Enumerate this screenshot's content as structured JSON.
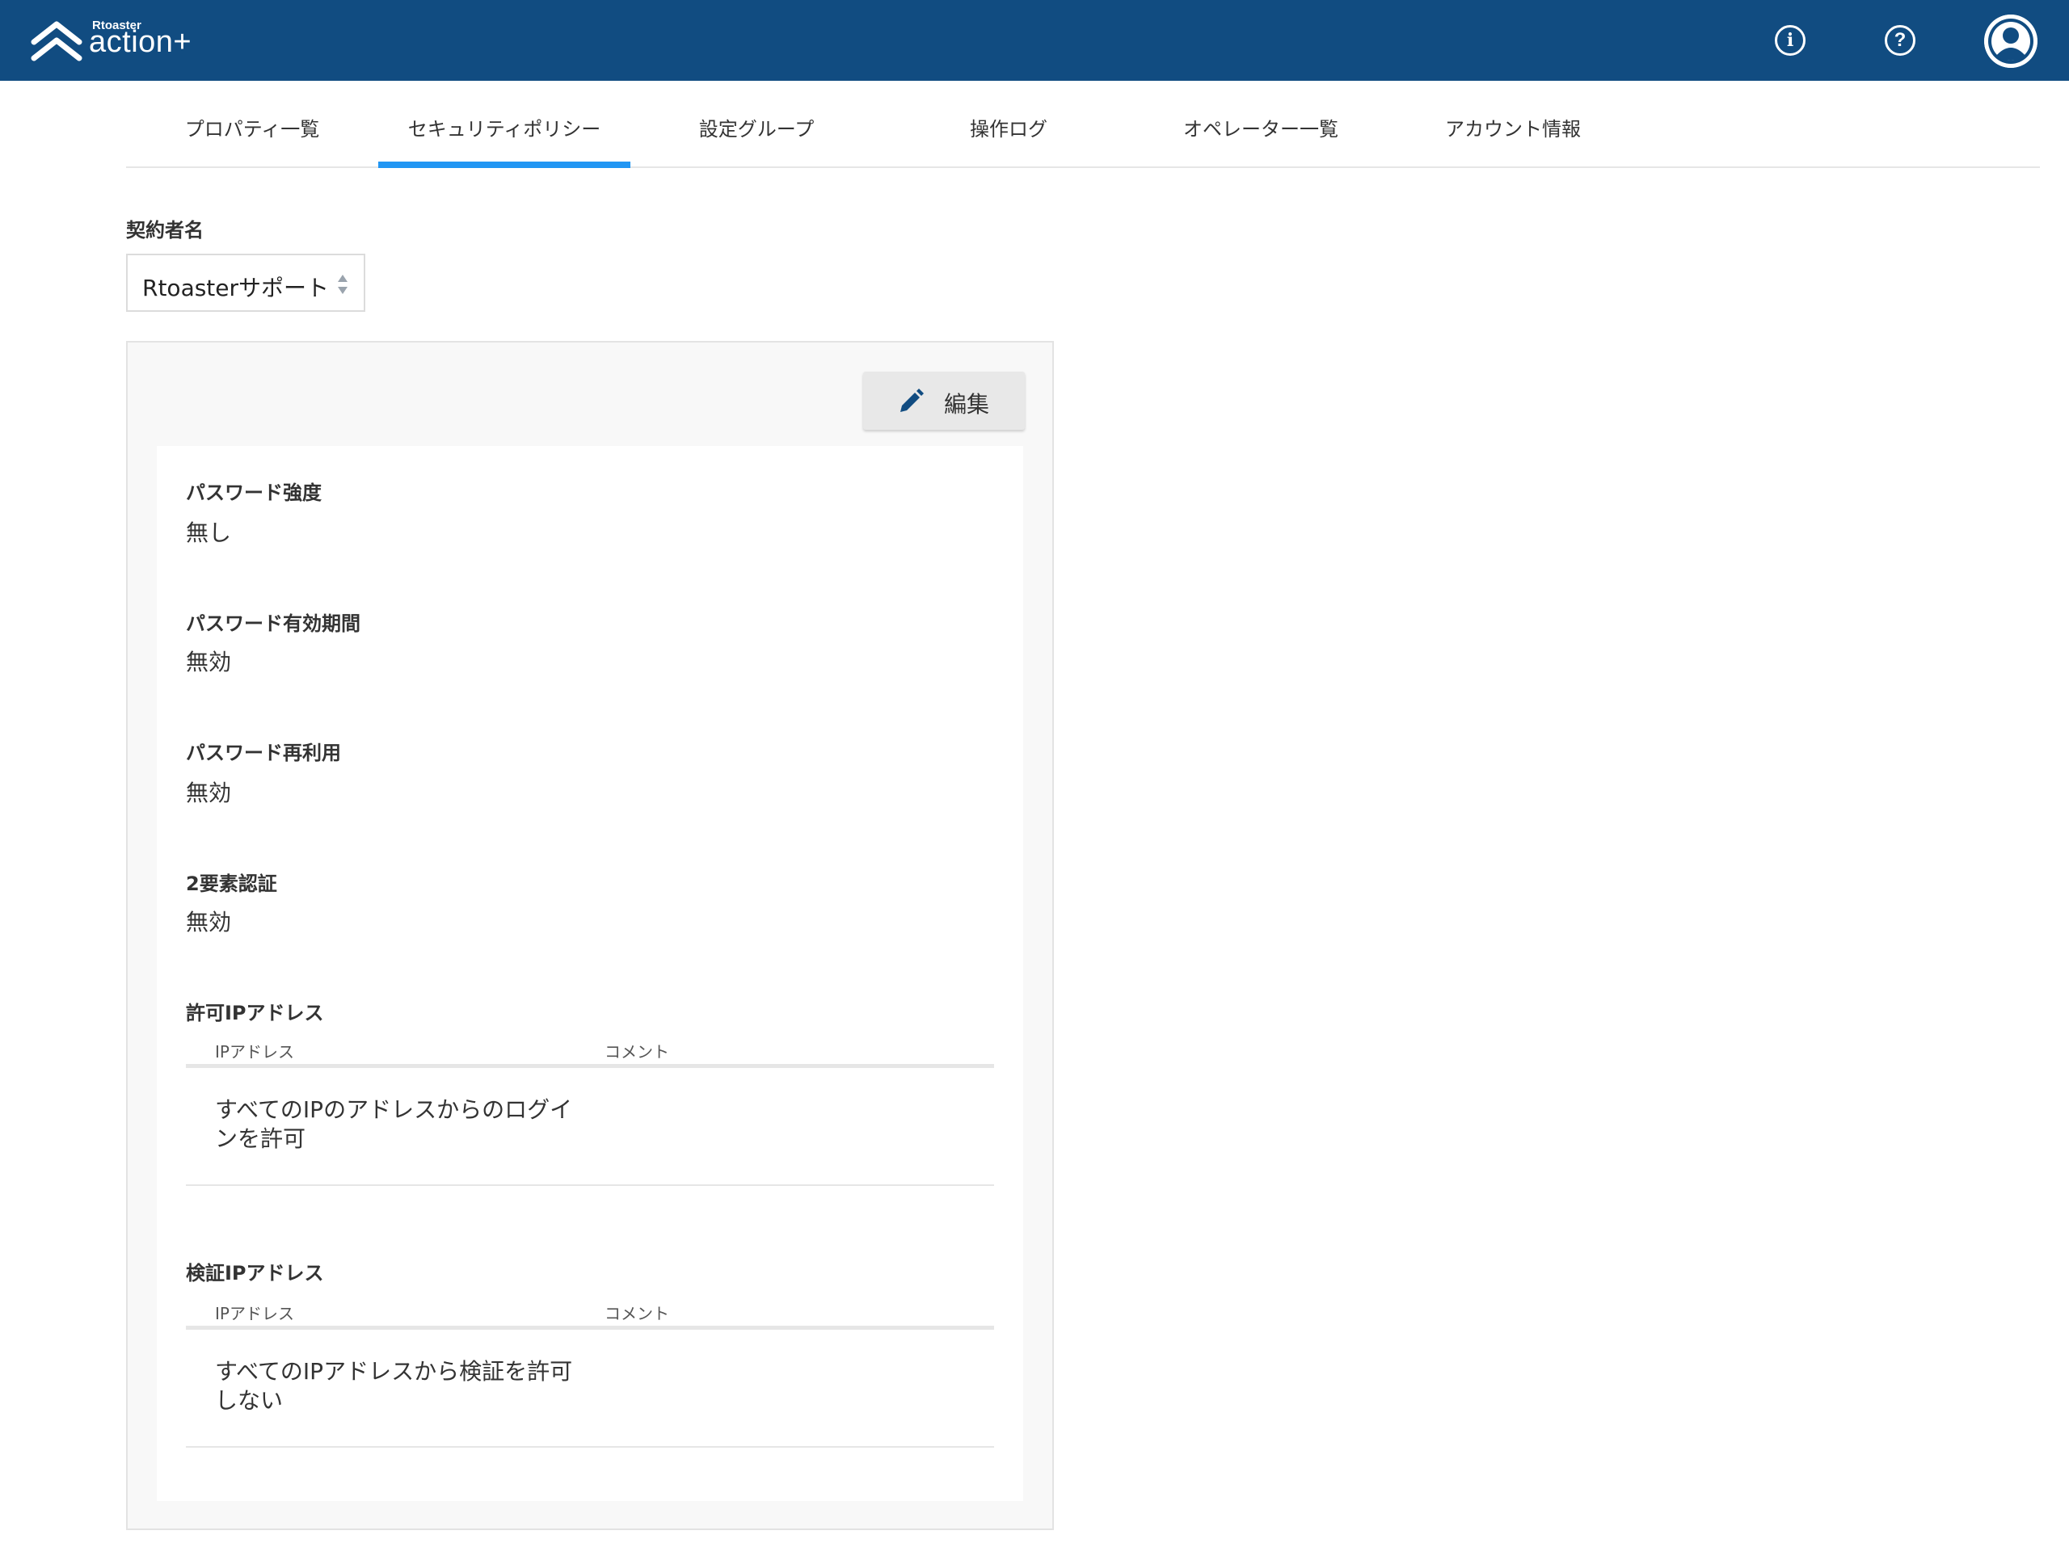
{
  "header": {
    "logo_small": "Rtoaster",
    "logo_main": "action+",
    "icons": [
      "logo-chevron-icon",
      "info-icon",
      "help-icon",
      "user-avatar-icon"
    ],
    "info_glyph": "i",
    "help_glyph": "?",
    "background": "#114c81"
  },
  "tabs": [
    {
      "label": "プロパティ一覧",
      "active": false
    },
    {
      "label": "セキュリティポリシー",
      "active": true
    },
    {
      "label": "設定グループ",
      "active": false
    },
    {
      "label": "操作ログ",
      "active": false
    },
    {
      "label": "オペレーター一覧",
      "active": false
    },
    {
      "label": "アカウント情報",
      "active": false
    }
  ],
  "accent": "#2196f3",
  "contract": {
    "label": "契約者名",
    "selected": "Rtoasterサポート"
  },
  "panel": {
    "edit_label": "編集",
    "edit_icon": "pencil-icon",
    "sections": [
      {
        "title": "パスワード強度",
        "value": "無し"
      },
      {
        "title": "パスワード有効期間",
        "value": "無効"
      },
      {
        "title": "パスワード再利用",
        "value": "無効"
      },
      {
        "title": "2要素認証",
        "value": "無効"
      }
    ],
    "allowed_ip": {
      "title": "許可IPアドレス",
      "columns": [
        "IPアドレス",
        "コメント"
      ],
      "rows": [
        {
          "ip": "すべてのIPのアドレスからのログインを許可",
          "comment": ""
        }
      ]
    },
    "verify_ip": {
      "title": "検証IPアドレス",
      "columns": [
        "IPアドレス",
        "コメント"
      ],
      "rows": [
        {
          "ip": "すべてのIPアドレスから検証を許可しない",
          "comment": ""
        }
      ]
    }
  }
}
